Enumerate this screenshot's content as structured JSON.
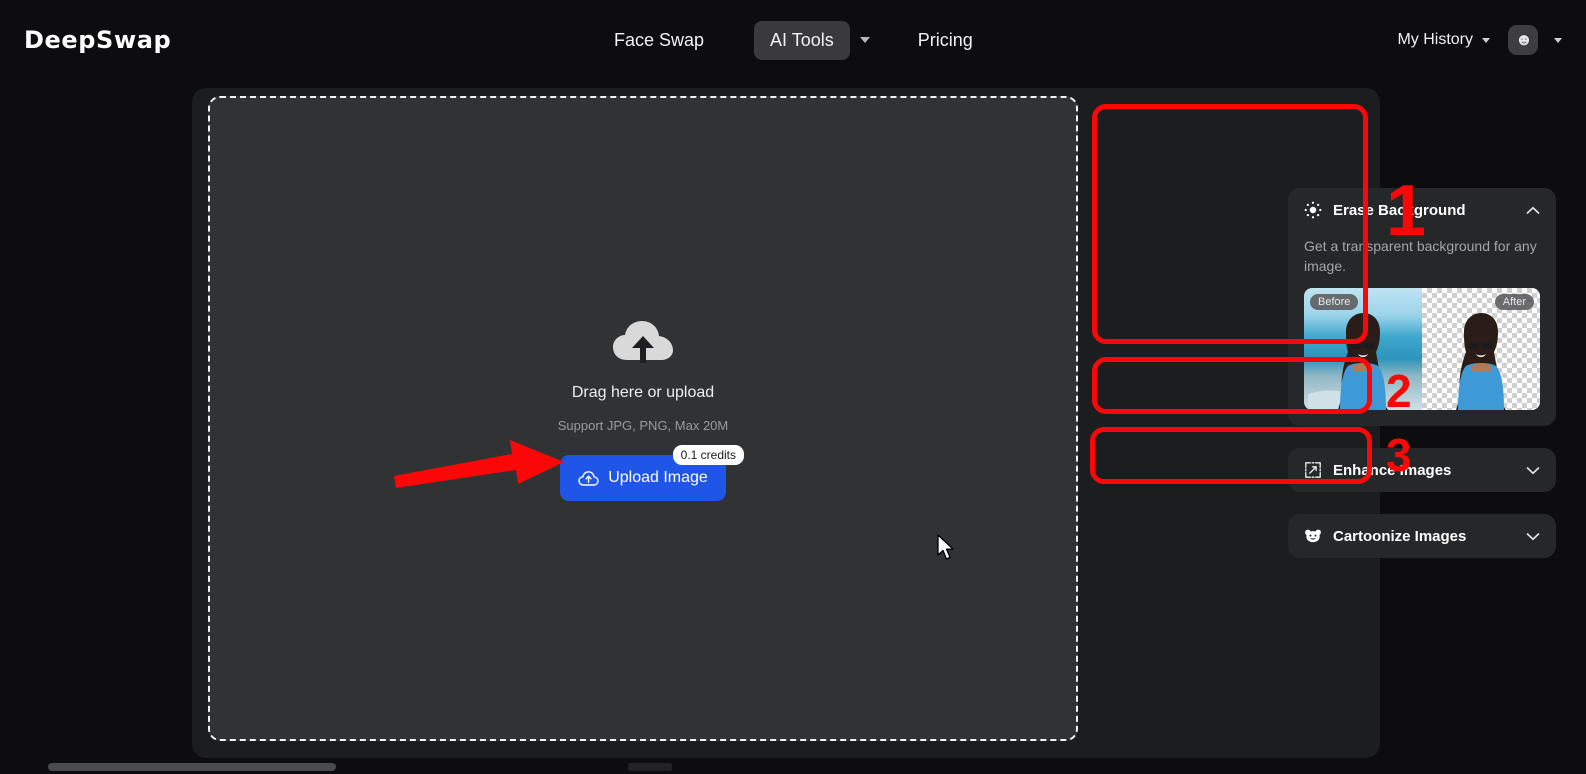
{
  "header": {
    "logo": "DeepSwap",
    "nav": [
      {
        "label": "Face Swap",
        "active": false
      },
      {
        "label": "AI Tools",
        "active": true
      },
      {
        "label": "Pricing",
        "active": false
      }
    ],
    "my_history": "My History",
    "avatar_glyph": "☻"
  },
  "dropzone": {
    "title": "Drag here or upload",
    "subtitle": "Support JPG, PNG, Max 20M",
    "upload_button": "Upload Image",
    "credits_badge": "0.1 credits"
  },
  "tools": [
    {
      "title": "Erase Background",
      "icon": "sun-dotted-icon",
      "expanded": true,
      "chevron": "chevron-up-icon",
      "description": "Get a transparent background for any image.",
      "preview": {
        "before_label": "Before",
        "after_label": "After"
      }
    },
    {
      "title": "Enhance Images",
      "icon": "expand-dashed-icon",
      "expanded": false,
      "chevron": "chevron-down-icon"
    },
    {
      "title": "Cartoonize Images",
      "icon": "bear-face-icon",
      "expanded": false,
      "chevron": "chevron-down-icon"
    }
  ],
  "annotations": {
    "numbers": [
      "1",
      "2",
      "3"
    ],
    "color": "#fb0707"
  },
  "colors": {
    "accent_blue": "#1f56e8",
    "annotation_red": "#fb0707",
    "page_bg": "#0d0d0f",
    "panel_bg": "#1c1d1f",
    "dropzone_bg": "#303234",
    "card_bg": "#262729"
  }
}
